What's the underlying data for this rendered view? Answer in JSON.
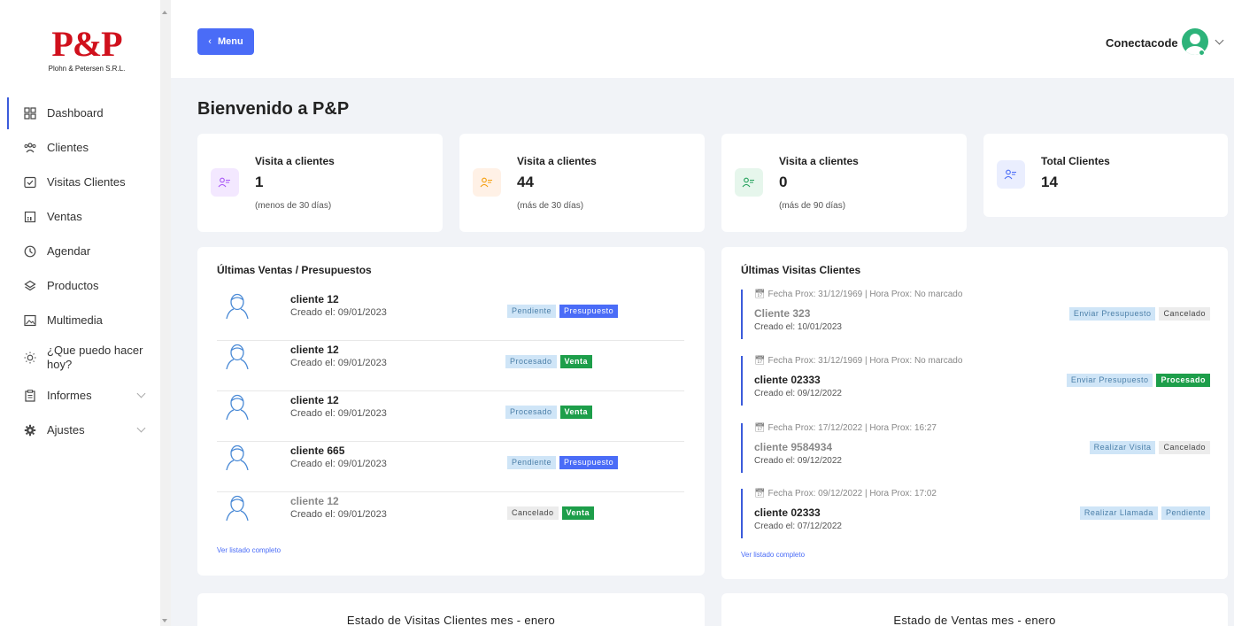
{
  "brand": {
    "logo_mark": "P&P",
    "logo_sub": "Plohn & Petersen S.R.L."
  },
  "sidebar": {
    "items": [
      {
        "label": "Dashboard",
        "icon": "grid-icon"
      },
      {
        "label": "Clientes",
        "icon": "users-icon"
      },
      {
        "label": "Visitas Clientes",
        "icon": "check-square-icon"
      },
      {
        "label": "Ventas",
        "icon": "calculator-icon"
      },
      {
        "label": "Agendar",
        "icon": "clock-icon"
      },
      {
        "label": "Productos",
        "icon": "layers-icon"
      },
      {
        "label": "Multimedia",
        "icon": "image-icon"
      },
      {
        "label": "¿Que puedo hacer hoy?",
        "icon": "bulb-icon"
      },
      {
        "label": "Informes",
        "icon": "clipboard-icon"
      },
      {
        "label": "Ajustes",
        "icon": "gear-icon"
      }
    ]
  },
  "header": {
    "menu_label": "Menu",
    "user_name": "Conectacode"
  },
  "page": {
    "title": "Bienvenido a P&P"
  },
  "stats": [
    {
      "title": "Visita a clientes",
      "value": "1",
      "sub": "(menos de 30 días)",
      "color": "#a855f7",
      "bg": "#f3e8ff"
    },
    {
      "title": "Visita a clientes",
      "value": "44",
      "sub": "(más de 30 días)",
      "color": "#f59e0b",
      "bg": "#fff1e6"
    },
    {
      "title": "Visita a clientes",
      "value": "0",
      "sub": "(más de 90 días)",
      "color": "#22a05a",
      "bg": "#e6f6ec"
    },
    {
      "title": "Total Clientes",
      "value": "14",
      "sub": "",
      "color": "#4a6cf7",
      "bg": "#eaeefe"
    }
  ],
  "sales": {
    "title": "Últimas Ventas / Presupuestos",
    "rows": [
      {
        "name": "cliente 12",
        "date": "Creado el: 09/01/2023",
        "status": "Pendiente",
        "type": "Presupuesto"
      },
      {
        "name": "cliente 12",
        "date": "Creado el: 09/01/2023",
        "status": "Procesado",
        "type": "Venta"
      },
      {
        "name": "cliente 12",
        "date": "Creado el: 09/01/2023",
        "status": "Procesado",
        "type": "Venta"
      },
      {
        "name": "cliente 665",
        "date": "Creado el: 09/01/2023",
        "status": "Pendiente",
        "type": "Presupuesto"
      },
      {
        "name": "cliente 12",
        "date": "Creado el: 09/01/2023",
        "status": "Cancelado",
        "type": "Venta"
      }
    ],
    "link": "Ver listado completo"
  },
  "visits": {
    "title": "Últimas Visitas Clientes",
    "rows": [
      {
        "meta": "Fecha Prox: 31/12/1969 | Hora Prox: No marcado",
        "name": "Cliente 323",
        "date": "Creado el: 10/01/2023",
        "action": "Enviar Presupuesto",
        "status": "Cancelado"
      },
      {
        "meta": "Fecha Prox: 31/12/1969 | Hora Prox: No marcado",
        "name": "cliente 02333",
        "date": "Creado el: 09/12/2022",
        "action": "Enviar Presupuesto",
        "status": "Procesado"
      },
      {
        "meta": "Fecha Prox: 17/12/2022 | Hora Prox: 16:27",
        "name": "cliente 9584934",
        "date": "Creado el: 09/12/2022",
        "action": "Realizar Visita",
        "status": "Cancelado"
      },
      {
        "meta": "Fecha Prox: 09/12/2022 | Hora Prox: 17:02",
        "name": "cliente 02333",
        "date": "Creado el: 07/12/2022",
        "action": "Realizar Llamada",
        "status": "Pendiente"
      }
    ],
    "link": "Ver listado completo"
  },
  "bottom": {
    "left_title": "Estado de Visitas Clientes mes - enero",
    "right_title": "Estado de Ventas mes - enero"
  }
}
